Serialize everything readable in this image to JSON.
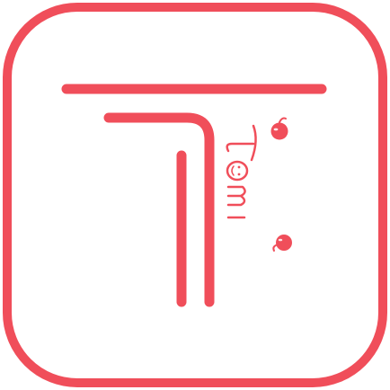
{
  "logo": {
    "name": "Tomi",
    "wordmark": "Tomi"
  },
  "colors": {
    "brand": "#f04e5a",
    "background": "#ffffff"
  }
}
